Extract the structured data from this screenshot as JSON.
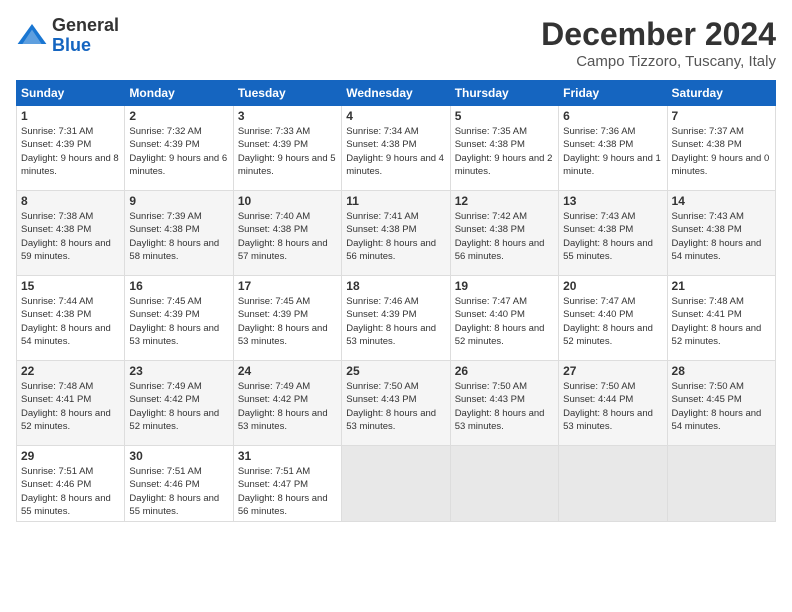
{
  "logo": {
    "general": "General",
    "blue": "Blue"
  },
  "title": "December 2024",
  "location": "Campo Tizzoro, Tuscany, Italy",
  "days_of_week": [
    "Sunday",
    "Monday",
    "Tuesday",
    "Wednesday",
    "Thursday",
    "Friday",
    "Saturday"
  ],
  "weeks": [
    [
      {
        "day": 1,
        "sunrise": "7:31 AM",
        "sunset": "4:39 PM",
        "daylight": "9 hours and 8 minutes."
      },
      {
        "day": 2,
        "sunrise": "7:32 AM",
        "sunset": "4:39 PM",
        "daylight": "9 hours and 6 minutes."
      },
      {
        "day": 3,
        "sunrise": "7:33 AM",
        "sunset": "4:39 PM",
        "daylight": "9 hours and 5 minutes."
      },
      {
        "day": 4,
        "sunrise": "7:34 AM",
        "sunset": "4:38 PM",
        "daylight": "9 hours and 4 minutes."
      },
      {
        "day": 5,
        "sunrise": "7:35 AM",
        "sunset": "4:38 PM",
        "daylight": "9 hours and 2 minutes."
      },
      {
        "day": 6,
        "sunrise": "7:36 AM",
        "sunset": "4:38 PM",
        "daylight": "9 hours and 1 minute."
      },
      {
        "day": 7,
        "sunrise": "7:37 AM",
        "sunset": "4:38 PM",
        "daylight": "9 hours and 0 minutes."
      }
    ],
    [
      {
        "day": 8,
        "sunrise": "7:38 AM",
        "sunset": "4:38 PM",
        "daylight": "8 hours and 59 minutes."
      },
      {
        "day": 9,
        "sunrise": "7:39 AM",
        "sunset": "4:38 PM",
        "daylight": "8 hours and 58 minutes."
      },
      {
        "day": 10,
        "sunrise": "7:40 AM",
        "sunset": "4:38 PM",
        "daylight": "8 hours and 57 minutes."
      },
      {
        "day": 11,
        "sunrise": "7:41 AM",
        "sunset": "4:38 PM",
        "daylight": "8 hours and 56 minutes."
      },
      {
        "day": 12,
        "sunrise": "7:42 AM",
        "sunset": "4:38 PM",
        "daylight": "8 hours and 56 minutes."
      },
      {
        "day": 13,
        "sunrise": "7:43 AM",
        "sunset": "4:38 PM",
        "daylight": "8 hours and 55 minutes."
      },
      {
        "day": 14,
        "sunrise": "7:43 AM",
        "sunset": "4:38 PM",
        "daylight": "8 hours and 54 minutes."
      }
    ],
    [
      {
        "day": 15,
        "sunrise": "7:44 AM",
        "sunset": "4:38 PM",
        "daylight": "8 hours and 54 minutes."
      },
      {
        "day": 16,
        "sunrise": "7:45 AM",
        "sunset": "4:39 PM",
        "daylight": "8 hours and 53 minutes."
      },
      {
        "day": 17,
        "sunrise": "7:45 AM",
        "sunset": "4:39 PM",
        "daylight": "8 hours and 53 minutes."
      },
      {
        "day": 18,
        "sunrise": "7:46 AM",
        "sunset": "4:39 PM",
        "daylight": "8 hours and 53 minutes."
      },
      {
        "day": 19,
        "sunrise": "7:47 AM",
        "sunset": "4:40 PM",
        "daylight": "8 hours and 52 minutes."
      },
      {
        "day": 20,
        "sunrise": "7:47 AM",
        "sunset": "4:40 PM",
        "daylight": "8 hours and 52 minutes."
      },
      {
        "day": 21,
        "sunrise": "7:48 AM",
        "sunset": "4:41 PM",
        "daylight": "8 hours and 52 minutes."
      }
    ],
    [
      {
        "day": 22,
        "sunrise": "7:48 AM",
        "sunset": "4:41 PM",
        "daylight": "8 hours and 52 minutes."
      },
      {
        "day": 23,
        "sunrise": "7:49 AM",
        "sunset": "4:42 PM",
        "daylight": "8 hours and 52 minutes."
      },
      {
        "day": 24,
        "sunrise": "7:49 AM",
        "sunset": "4:42 PM",
        "daylight": "8 hours and 53 minutes."
      },
      {
        "day": 25,
        "sunrise": "7:50 AM",
        "sunset": "4:43 PM",
        "daylight": "8 hours and 53 minutes."
      },
      {
        "day": 26,
        "sunrise": "7:50 AM",
        "sunset": "4:43 PM",
        "daylight": "8 hours and 53 minutes."
      },
      {
        "day": 27,
        "sunrise": "7:50 AM",
        "sunset": "4:44 PM",
        "daylight": "8 hours and 53 minutes."
      },
      {
        "day": 28,
        "sunrise": "7:50 AM",
        "sunset": "4:45 PM",
        "daylight": "8 hours and 54 minutes."
      }
    ],
    [
      {
        "day": 29,
        "sunrise": "7:51 AM",
        "sunset": "4:46 PM",
        "daylight": "8 hours and 55 minutes."
      },
      {
        "day": 30,
        "sunrise": "7:51 AM",
        "sunset": "4:46 PM",
        "daylight": "8 hours and 55 minutes."
      },
      {
        "day": 31,
        "sunrise": "7:51 AM",
        "sunset": "4:47 PM",
        "daylight": "8 hours and 56 minutes."
      },
      null,
      null,
      null,
      null
    ]
  ]
}
